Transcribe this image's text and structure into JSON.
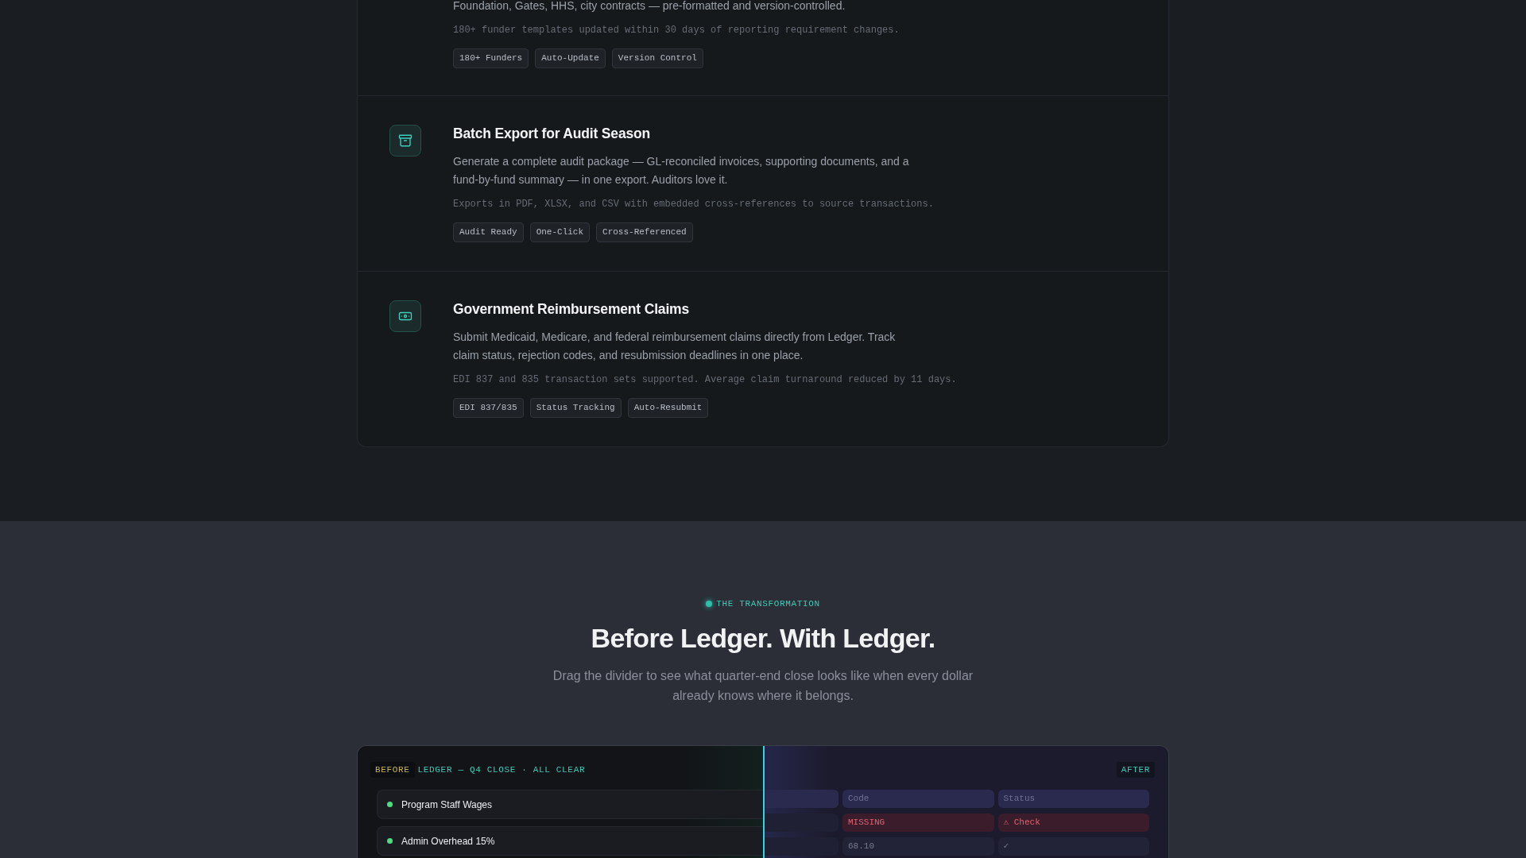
{
  "features": {
    "items": [
      {
        "description": "Foundation, Gates, HHS, city contracts — pre-formatted and version-controlled.",
        "note": "180+ funder templates updated within 30 days of reporting requirement changes.",
        "tags": [
          "180+ Funders",
          "Auto-Update",
          "Version Control"
        ]
      },
      {
        "title": "Batch Export for Audit Season",
        "description": "Generate a complete audit package — GL-reconciled invoices, supporting documents, and a fund-by-fund summary — in one export. Auditors love it.",
        "note": "Exports in PDF, XLSX, and CSV with embedded cross-references to source transactions.",
        "tags": [
          "Audit Ready",
          "One-Click",
          "Cross-Referenced"
        ]
      },
      {
        "title": "Government Reimbursement Claims",
        "description": "Submit Medicaid, Medicare, and federal reimbursement claims directly from Ledger. Track claim status, rejection codes, and resubmission deadlines in one place.",
        "note": "EDI 837 and 835 transaction sets supported. Average claim turnaround reduced by 11 days.",
        "tags": [
          "EDI 837/835",
          "Status Tracking",
          "Auto-Resubmit"
        ]
      }
    ]
  },
  "transformation": {
    "eyebrow": "THE TRANSFORMATION",
    "title": "Before Ledger. With Ledger.",
    "subtitle": "Drag the divider to see what quarter-end close looks like when every dollar already knows where it belongs."
  },
  "comparison": {
    "divider": {
      "level": 0.5
    },
    "left": {
      "badge": "BEFORE",
      "header": "LEDGER — Q4 CLOSE · ALL CLEAR",
      "rows": [
        {
          "label": "Program Staff Wages",
          "color": "#4ade80"
        },
        {
          "label": "Admin Overhead 15%",
          "color": "#4ade80"
        }
      ]
    },
    "right": {
      "badge": "AFTER",
      "partial_column": true,
      "columns": [
        "Code",
        "Status"
      ],
      "rows": [
        {
          "kind": "error",
          "cells": [
            "MISSING",
            "⚠ Check"
          ]
        },
        {
          "kind": "plain",
          "cells": [
            "68.10",
            "✓"
          ]
        }
      ]
    }
  }
}
